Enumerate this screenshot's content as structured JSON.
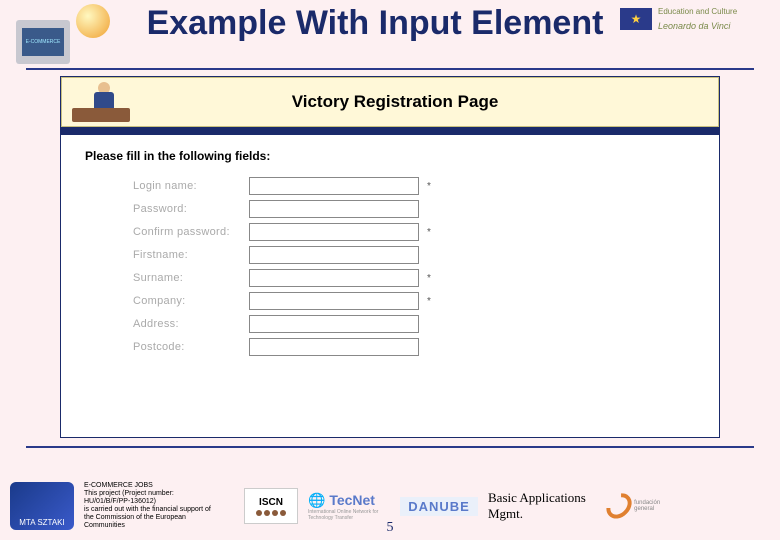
{
  "slide": {
    "title": "Example With Input Element",
    "page_number": "5"
  },
  "header_right": {
    "edu_culture": "Education and Culture",
    "leonardo": "Leonardo da Vinci"
  },
  "embedded_page": {
    "banner_title": "Victory Registration Page",
    "instruction": "Please fill in the following fields:",
    "fields": [
      {
        "label": "Login name:",
        "required": true
      },
      {
        "label": "Password:",
        "required": false
      },
      {
        "label": "Confirm password:",
        "required": true
      },
      {
        "label": "Firstname:",
        "required": false
      },
      {
        "label": "Surname:",
        "required": true
      },
      {
        "label": "Company:",
        "required": true
      },
      {
        "label": "Address:",
        "required": false
      },
      {
        "label": "Postcode:",
        "required": false
      }
    ]
  },
  "footer": {
    "project_text_1": "E-COMMERCE JOBS",
    "project_text_2": "This project (Project number:",
    "project_text_3": "HU/01/B/F/PP-136012)",
    "project_text_4": "is carried out with the financial support of",
    "project_text_5": "the Commission of the European",
    "project_text_6": "Communities",
    "mta": "MTA SZTAKI",
    "iscn": "ISCN",
    "tecnet": "TecNet",
    "tecnet_sub": "International Online Network for Technology Transfer",
    "danube": "DANUBE",
    "basic_apps": "Basic Applications Mgmt.",
    "fundacion": "fundación general"
  }
}
